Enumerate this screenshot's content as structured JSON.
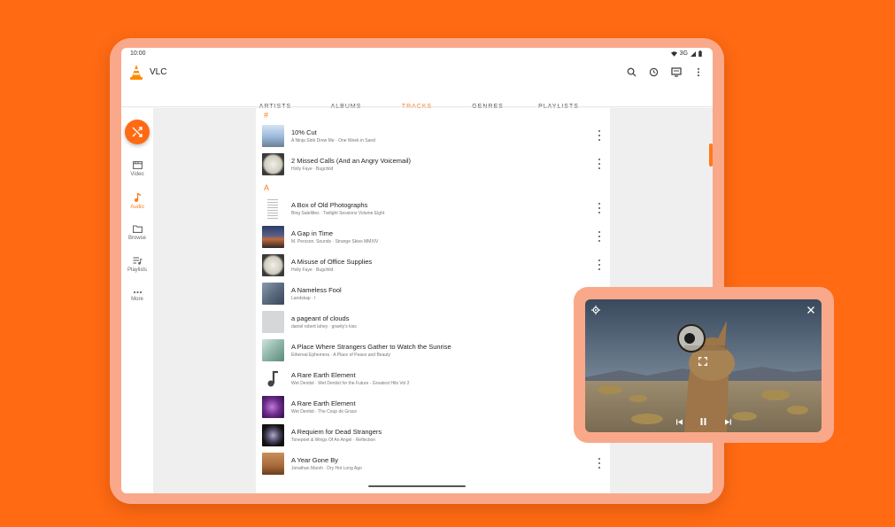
{
  "status_bar": {
    "time": "10:00",
    "network": "3G"
  },
  "app": {
    "title": "VLC"
  },
  "top_icons": [
    "search-icon",
    "history-icon",
    "renderer-icon",
    "more-vert-icon"
  ],
  "tabs": [
    {
      "label": "ARTISTS",
      "active": false
    },
    {
      "label": "ALBUMS",
      "active": false
    },
    {
      "label": "TRACKS",
      "active": true
    },
    {
      "label": "GENRES",
      "active": false
    },
    {
      "label": "PLAYLISTS",
      "active": false
    }
  ],
  "nav": [
    {
      "label": "Video",
      "icon": "video-icon",
      "active": false
    },
    {
      "label": "Audio",
      "icon": "music-note-icon",
      "active": true
    },
    {
      "label": "Browse",
      "icon": "folder-icon",
      "active": false
    },
    {
      "label": "Playlists",
      "icon": "playlist-icon",
      "active": false
    },
    {
      "label": "More",
      "icon": "more-horiz-icon",
      "active": false
    }
  ],
  "sections": [
    "#",
    "A"
  ],
  "tracks": [
    {
      "title": "10% Cut",
      "subtitle": "A Ninja Slob Drew Me · One Week in Sand",
      "section": "#",
      "has_menu": true
    },
    {
      "title": "2 Missed Calls (And an Angry Voicemail)",
      "subtitle": "Holly Faye · Bugchild",
      "section": "#",
      "has_menu": true
    },
    {
      "title": "A Box of Old Photographs",
      "subtitle": "Bing Satellites · Twilight Sessions Volume Eight",
      "section": "A",
      "has_menu": true
    },
    {
      "title": "A Gap in Time",
      "subtitle": "M. Persson. Sounds · Strange Skies MMXIV",
      "section": "A",
      "has_menu": true
    },
    {
      "title": "A Misuse of Office Supplies",
      "subtitle": "Holly Faye · Bugchild",
      "section": "A",
      "has_menu": true
    },
    {
      "title": "A Nameless Fool",
      "subtitle": "Landskap · I",
      "section": "A",
      "has_menu": false
    },
    {
      "title": "a pageant of clouds",
      "subtitle": "daniel robert lahey · gravity's kiss",
      "section": "A",
      "has_menu": false
    },
    {
      "title": "A Place Where Strangers Gather to Watch the Sunrise",
      "subtitle": "Ethereal Ephemera · A Place of Peace and Beauty",
      "section": "A",
      "has_menu": false
    },
    {
      "title": "A Rare Earth Element",
      "subtitle": "Wet Dentist · Wet Dentist for the Future - Greatest Hits Vol 2",
      "section": "A",
      "has_menu": false
    },
    {
      "title": "A Rare Earth Element",
      "subtitle": "Wet Dentist · The Coup de Grace",
      "section": "A",
      "has_menu": false
    },
    {
      "title": "A Requiem for Dead Strangers",
      "subtitle": "Tonepoet & Wings Of An Angel · Reflection",
      "section": "A",
      "has_menu": false
    },
    {
      "title": "A Year Gone By",
      "subtitle": "Jonathan Marsh · Dry Hot Long Ago",
      "section": "A",
      "has_menu": true
    }
  ],
  "pip": {
    "state": "playing",
    "controls": [
      "settings-icon",
      "close-icon",
      "fullscreen-icon",
      "previous-icon",
      "pause-icon",
      "next-icon"
    ]
  },
  "colors": {
    "accent": "#ff7a1a",
    "background": "#ff6a13",
    "frame": "#f9a98a"
  }
}
